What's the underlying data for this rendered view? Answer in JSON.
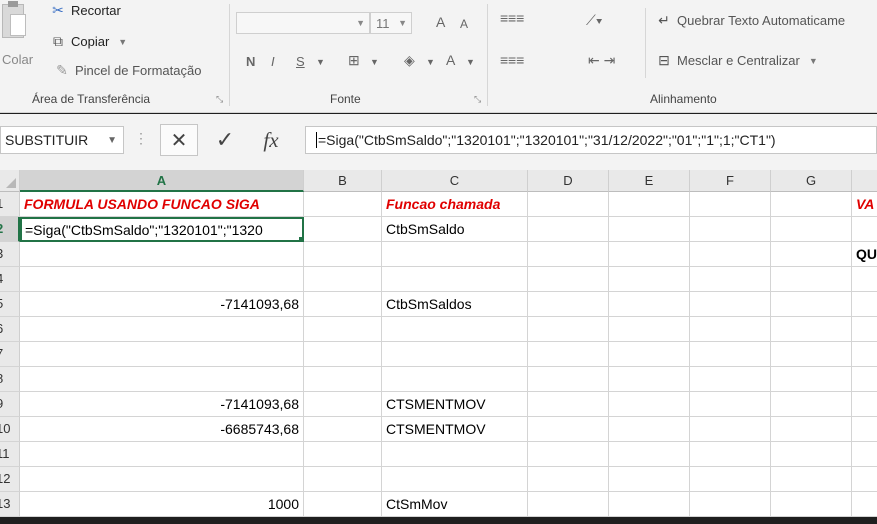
{
  "ribbon": {
    "clipboard": {
      "paste_label": "Colar",
      "cut_label": "Recortar",
      "copy_label": "Copiar",
      "format_painter_label": "Pincel de Formatação",
      "group_label": "Área de Transferência"
    },
    "font": {
      "font_name": "",
      "font_size": "11",
      "bold": "N",
      "italic": "I",
      "underline": "S",
      "grow_font": "A",
      "shrink_font": "A",
      "font_color": "A",
      "group_label": "Fonte"
    },
    "alignment": {
      "wrap_text_label": "Quebrar Texto Automaticame",
      "merge_center_label": "Mesclar e Centralizar",
      "group_label": "Alinhamento"
    }
  },
  "formula_bar": {
    "name_box": "SUBSTITUIR",
    "cancel_icon": "✕",
    "enter_icon": "✓",
    "fx_label": "fx",
    "formula": "=Siga(\"CtbSmSaldo\";\"1320101\";\"1320101\";\"31/12/2022\";\"01\";\"1\";1;\"CT1\")"
  },
  "columns": [
    "A",
    "B",
    "C",
    "D",
    "E",
    "F",
    "G"
  ],
  "rows": [
    "1",
    "2",
    "3",
    "4",
    "5",
    "6",
    "7",
    "8",
    "9",
    "10",
    "11",
    "12",
    "13"
  ],
  "cells": {
    "A1": "FORMULA USANDO FUNCAO SIGA",
    "C1": "Funcao chamada",
    "H1": "VA",
    "A2": "=Siga(\"CtbSmSaldo\";\"1320101\";\"1320",
    "C2": "CtbSmSaldo",
    "H3": "QU",
    "A5": "-7141093,68",
    "C5": "CtbSmSaldos",
    "A9": "-7141093,68",
    "C9": "CTSMENTMOV",
    "A10": "-6685743,68",
    "C10": "CTSMENTMOV",
    "A13": "1000",
    "C13": "CtSmMov"
  },
  "colors": {
    "accent": "#217346",
    "header_red": "#e00000"
  }
}
